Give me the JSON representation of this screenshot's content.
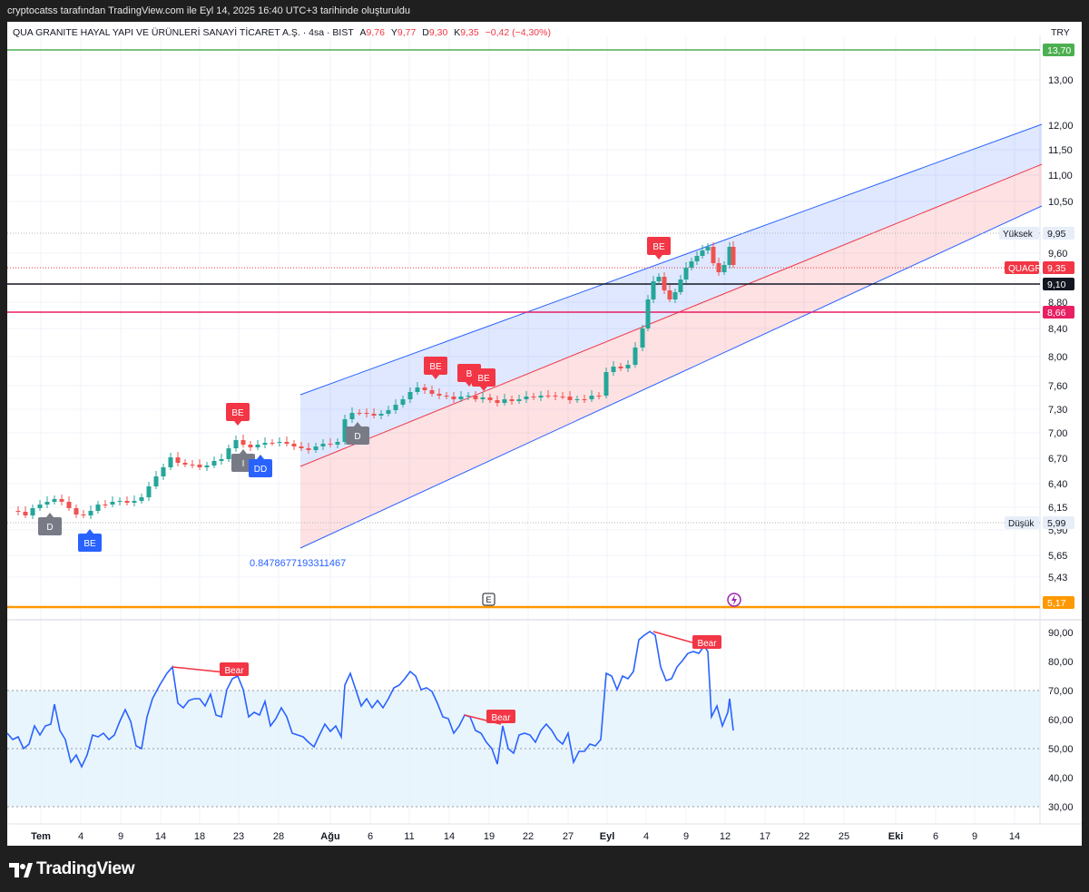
{
  "header": {
    "caption": "cryptocatss tarafından TradingView.com ile Eyl 14, 2025 16:40 UTC+3 tarihinde oluşturuldu"
  },
  "legend": {
    "symbol": "QUA GRANITE HAYAL YAPI VE ÜRÜNLERİ SANAYİ TİCARET A.Ş. · 4sa · BIST",
    "open_label": "A",
    "open": "9,76",
    "high_label": "Y",
    "high": "9,77",
    "low_label": "D",
    "low": "9,30",
    "close_label": "K",
    "close": "9,35",
    "change": "−0,42 (−4,30%)"
  },
  "currency": "TRY",
  "price_axis": {
    "ticks": [
      "13,00",
      "12,00",
      "11,50",
      "11,00",
      "10,50",
      "9,60",
      "8,80",
      "8,40",
      "8,00",
      "7,60",
      "7,30",
      "7,00",
      "6,70",
      "6,40",
      "6,15",
      "5,90",
      "5,65",
      "5,43"
    ],
    "badges": [
      {
        "text": "13,70",
        "color": "#4caf50"
      },
      {
        "text": "9,95",
        "label": "Yüksek",
        "color": "#e8eef8"
      },
      {
        "text": "9,35",
        "label": "QUAGR",
        "color": "#f23645"
      },
      {
        "text": "9,10",
        "color": "#131722"
      },
      {
        "text": "8,66",
        "color": "#e91e63"
      },
      {
        "text": "5,99",
        "label": "Düşük",
        "color": "#e8eef8"
      },
      {
        "text": "5,17",
        "color": "#ff9800"
      }
    ]
  },
  "rsi_axis": {
    "ticks": [
      "90,00",
      "80,00",
      "70,00",
      "60,00",
      "50,00",
      "40,00",
      "30,00"
    ]
  },
  "time_axis": {
    "ticks": [
      "Tem",
      "4",
      "9",
      "14",
      "18",
      "23",
      "28",
      "Ağu",
      "6",
      "11",
      "14",
      "19",
      "22",
      "27",
      "Eyl",
      "4",
      "9",
      "12",
      "17",
      "22",
      "25",
      "Eki",
      "6",
      "9",
      "14"
    ]
  },
  "annotations": {
    "channel_value": "0.8478677193311467",
    "event_e": "E",
    "signal_labels": [
      "BE",
      "BE",
      "B",
      "BE",
      "BE"
    ],
    "pattern_labels": [
      "D",
      "BE",
      "D",
      "I",
      "DD"
    ],
    "bear_labels": [
      "Bear",
      "Bear",
      "Bear"
    ]
  },
  "colors": {
    "up": "#26a69a",
    "down": "#ef5350",
    "rsi": "#2962ff",
    "channel_blue": "#2962ff",
    "channel_red": "#f23645"
  },
  "brand": {
    "name": "TradingView"
  }
}
